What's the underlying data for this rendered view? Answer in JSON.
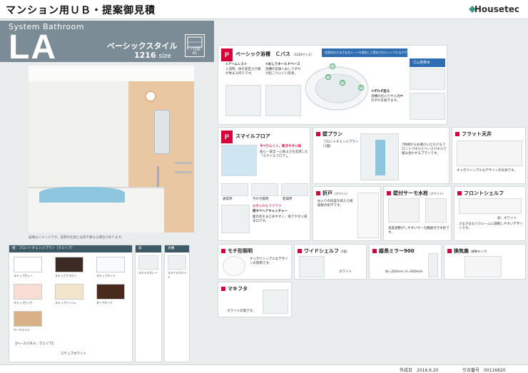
{
  "header": {
    "title": "マンション用ＵＢ・提案御見積",
    "brand": "Housetec"
  },
  "series": {
    "en": "System Bathroom",
    "code": "LA",
    "style": "ベーシックスタイル",
    "size": "1216",
    "size_unit": "size",
    "door": "ドア位置：A1"
  },
  "photo_note": "画像はイメージです。実際の仕様とは若干異なる場合があります。",
  "features": {
    "tub": {
      "title": "ベーシック浴槽　Ｃバス",
      "sub": "（1216サイズ）",
      "blue": "浴室内のさまざまなシーンを想定して設計されたシンプルなデザインです。",
      "p1_title": "①アームレスト",
      "p1_text": "入浴時、体を安定させ腕が休まる作りです。",
      "p2_title": "②おしりホールドベース",
      "p2_text": "浴槽の前後へおしりずれが起こりにくい形状。",
      "p3_title": "③ずれず座る",
      "p3_text": "浴槽の出入りや入浴中のずれを防ぎます。",
      "drain": "ゴム栓排水"
    },
    "floor": {
      "title": "スマイルフロア",
      "text": "すべりにくく、乾きやすい床",
      "text2": "安心・安全・心地よさを追求した「スマイルフロア」。",
      "s1": "通常時",
      "s2": "汚れ付着時",
      "s3": "乾燥時",
      "clean_title": "お手入れもラクラク",
      "clean_sub": "楽すべヘアキャッチャー",
      "clean_text": "髪の毛をまとめやすく、捨てやすい排水口です。"
    },
    "wall": {
      "title": "壁プラン",
      "t1": "フロントチェンジプラン(1面)",
      "t2": "7色柄からお選びいただけるフロントパネルとベースパネルで組み合わせるプランです。"
    },
    "flat": {
      "title": "フラット天井",
      "text": "すっきりシンプルなデザインの天井です。"
    },
    "door": {
      "title": "折戸",
      "sub": "（ホワイト）",
      "text": "お入りの段差を抑えた樹脂製の折戸です。"
    },
    "faucet": {
      "title": "壁付サーモ水栓",
      "sub": "（ホワイト）",
      "text": "温度調整がしやすいサーモ機能付き水栓です。"
    },
    "shelf": {
      "title": "フロントシェルフ",
      "color": "枠：ホワイト",
      "text": "さまざまなバスルームに調和しやすいデザインです。"
    },
    "light": {
      "title": "モチ形照明",
      "text": "すっきりシンプルなデザインの照明です。"
    },
    "wide": {
      "title": "ワイドシェルフ",
      "sub": "（2段）",
      "note": "ホワイト"
    },
    "mirror": {
      "title": "縦長ミラー900",
      "size1": "W=200mm",
      "size2": "H=900mm"
    },
    "vent": {
      "title": "換気扇",
      "sub": "（標準タイプ）"
    },
    "lid": {
      "title": "マキフタ",
      "text": "ホワイトの蓋です。"
    }
  },
  "colors": {
    "wall_header": "壁：フロントチェンジプラン（ラミリア）",
    "floor_header": "床",
    "tub_header": "浴槽",
    "swatches": [
      {
        "name": "ステップグレー",
        "color": "#ffffff"
      },
      {
        "name": "ステップブラウン",
        "color": "#3b2b24"
      },
      {
        "name": "ステップミント",
        "color": "#f8fbfb"
      },
      {
        "name": "ステップピンク",
        "color": "#f7ddd3"
      },
      {
        "name": "ステップベージュ",
        "color": "#f3e4cc"
      },
      {
        "name": "ダークチーク",
        "color": "#4a2a1d"
      },
      {
        "name": "チークライト",
        "color": "#d9b187"
      }
    ],
    "base_panel": "【ベースパネル：ラミリア】",
    "base_color": "ステップホワイト",
    "floor_color": "スマイルグレー",
    "tub_color": "スマイルホワイト"
  },
  "footer": {
    "date": "作成日　2016.6.20",
    "quote_no": "引合番号　00116620"
  }
}
